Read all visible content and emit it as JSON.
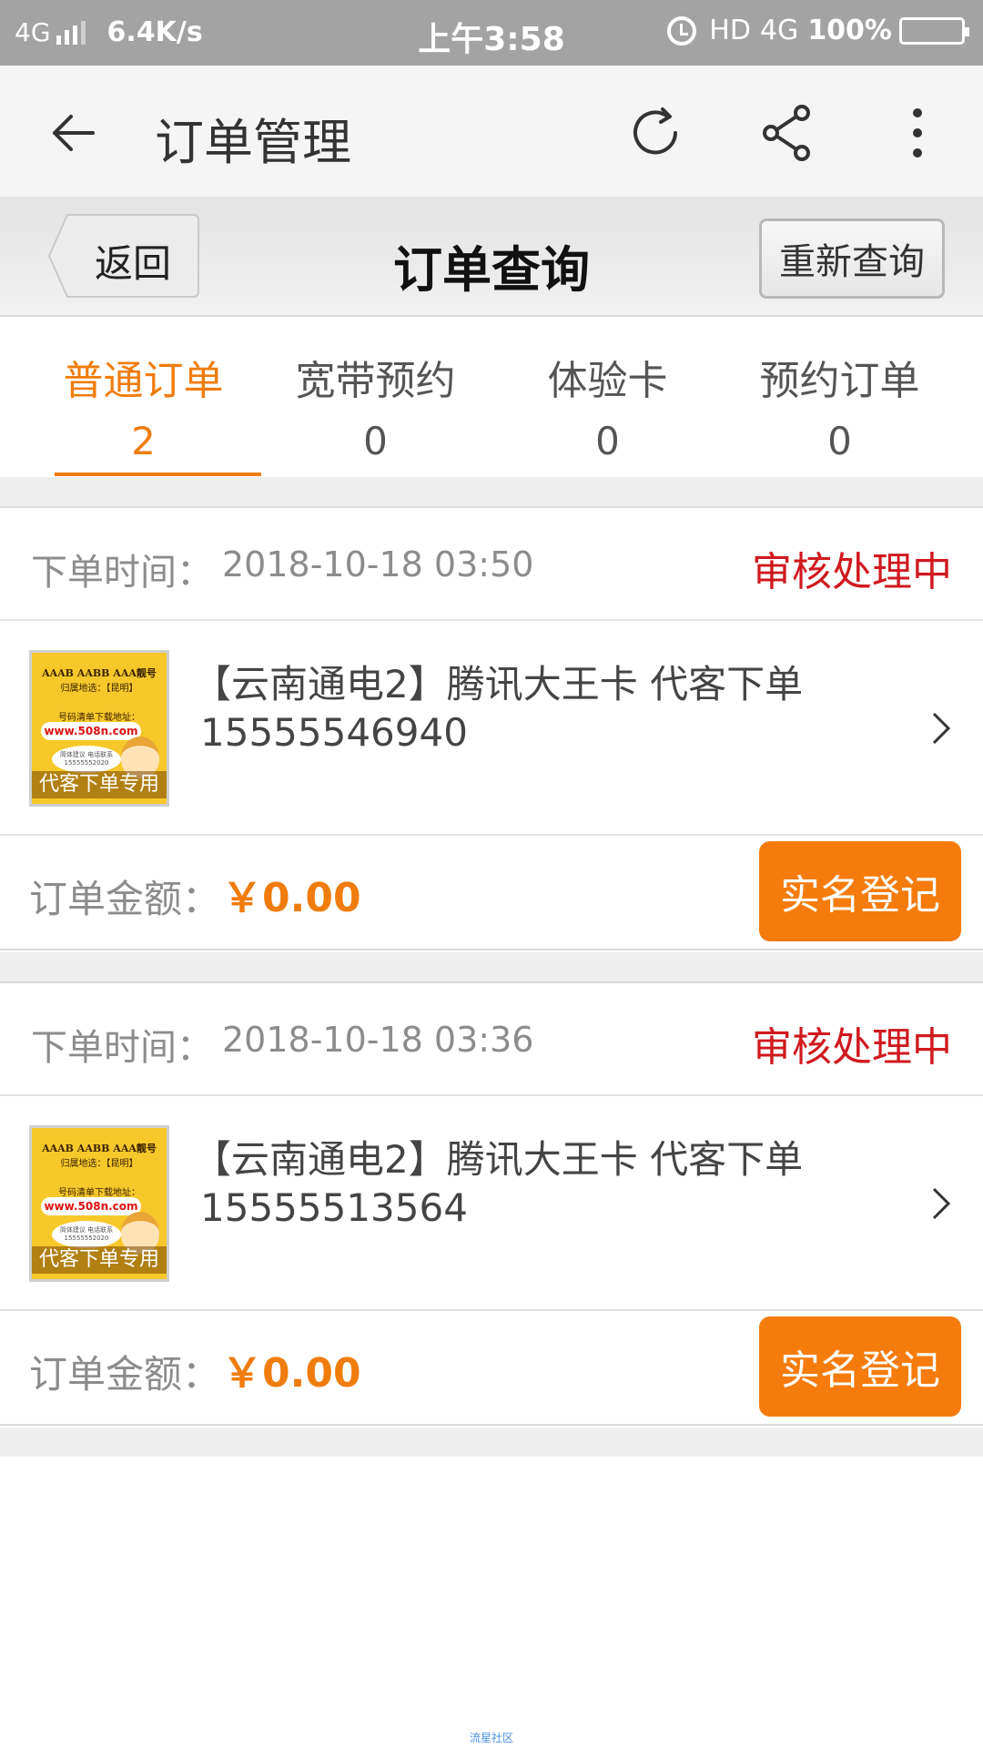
{
  "status_bar": {
    "network": "4G",
    "speed": "6.4K/s",
    "time": "上午3:58",
    "hd": "HD",
    "net2": "4G",
    "battery": "100%"
  },
  "app_bar": {
    "title": "订单管理",
    "icons": [
      "back-arrow-icon",
      "refresh-icon",
      "share-icon",
      "more-vert-icon"
    ]
  },
  "query_header": {
    "back_label": "返回",
    "title": "订单查询",
    "requery_label": "重新查询"
  },
  "tabs": [
    {
      "label": "普通订单",
      "count": "2",
      "active": true
    },
    {
      "label": "宽带预约",
      "count": "0",
      "active": false
    },
    {
      "label": "体验卡",
      "count": "0",
      "active": false
    },
    {
      "label": "预约订单",
      "count": "0",
      "active": false
    }
  ],
  "orders": [
    {
      "time_label": "下单时间：",
      "time": "2018-10-18   03:50",
      "status": "审核处理中",
      "product_title": "【云南通电2】腾讯大王卡 代客下单",
      "phone": "15555546940",
      "amount_label": "订单金额：",
      "amount": "￥0.00",
      "action_label": "实名登记",
      "thumb": {
        "line1": "AAAB AABB AAA靓号",
        "line2": "归属地选：【昆明】",
        "line3": "号码清单下载地址：",
        "url": "www.508n.com",
        "bubble": "简体建议 电话联系 15555552020",
        "banner": "代客下单专用"
      }
    },
    {
      "time_label": "下单时间：",
      "time": "2018-10-18   03:36",
      "status": "审核处理中",
      "product_title": "【云南通电2】腾讯大王卡 代客下单",
      "phone": "15555513564",
      "amount_label": "订单金额：",
      "amount": "￥0.00",
      "action_label": "实名登记",
      "thumb": {
        "line1": "AAAB AABB AAA靓号",
        "line2": "归属地选：【昆明】",
        "line3": "号码清单下载地址：",
        "url": "www.508n.com",
        "bubble": "简体建议 电话联系 15555552020",
        "banner": "代客下单专用"
      }
    }
  ],
  "watermark": "流星社区",
  "colors": {
    "accent": "#f07c0c",
    "status_red": "#d0191f",
    "statusbar_bg": "#a3a3a3"
  }
}
